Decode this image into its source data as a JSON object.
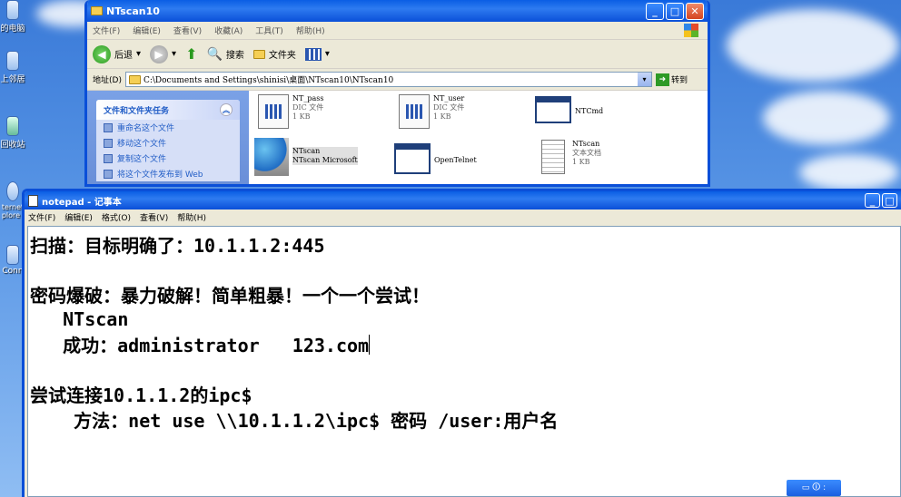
{
  "desktop": {
    "icons": [
      {
        "label": "的电脑",
        "icon": "my-computer-icon"
      },
      {
        "label": "上邻居",
        "icon": "network-icon"
      },
      {
        "label": "回收站",
        "icon": "recycle-bin-icon"
      },
      {
        "label": "ternet\nplore",
        "icon": "ie-icon"
      },
      {
        "label": "Conn",
        "icon": "connection-icon"
      }
    ]
  },
  "explorer": {
    "title": "NTscan10",
    "menu": [
      "文件(F)",
      "编辑(E)",
      "查看(V)",
      "收藏(A)",
      "工具(T)",
      "帮助(H)"
    ],
    "toolbar": {
      "back": "后退",
      "search": "搜索",
      "folders": "文件夹"
    },
    "address_label": "地址(D)",
    "address_value": "C:\\Documents and Settings\\shinisi\\桌面\\NTscan10\\NTscan10",
    "go_label": "转到",
    "tasks_header": "文件和文件夹任务",
    "tasks": [
      "重命名这个文件",
      "移动这个文件",
      "复制这个文件",
      "将这个文件发布到 Web"
    ],
    "files": [
      {
        "name": "NT_pass",
        "line2": "DIC 文件",
        "line3": "1 KB",
        "type": "dic"
      },
      {
        "name": "NT_user",
        "line2": "DIC 文件",
        "line3": "1 KB",
        "type": "dic"
      },
      {
        "name": "NTCmd",
        "line2": "",
        "line3": "",
        "type": "app"
      },
      {
        "name": "NTscan",
        "line2": "NTscan Microsoft",
        "line3": "",
        "type": "net"
      },
      {
        "name": "OpenTelnet",
        "line2": "",
        "line3": "",
        "type": "app"
      },
      {
        "name": "NTscan",
        "line2": "文本文档",
        "line3": "1 KB",
        "type": "txt"
      }
    ]
  },
  "notepad": {
    "title": "notepad - 记事本",
    "menu": [
      "文件(F)",
      "编辑(E)",
      "格式(O)",
      "查看(V)",
      "帮助(H)"
    ],
    "lines": [
      "扫描：目标明确了：10.1.1.2:445",
      "",
      "密码爆破：暴力破解！简单粗暴！一个一个尝试！",
      "   NTscan",
      "   成功：administrator   123.com",
      "",
      "尝试连接10.1.1.2的ipc$",
      "    方法：net use \\\\10.1.1.2\\ipc$ 密码 /user:用户名"
    ]
  },
  "ime": {
    "label": "▭ 🛈 :"
  }
}
